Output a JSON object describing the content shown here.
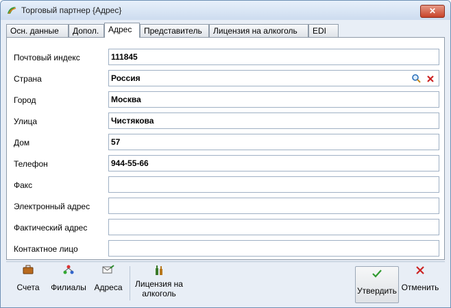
{
  "window": {
    "title": "Торговый партнер {Адрес}",
    "close_label": "✕"
  },
  "tabs": [
    {
      "label": "Осн. данные"
    },
    {
      "label": "Допол."
    },
    {
      "label": "Адрес"
    },
    {
      "label": "Представитель"
    },
    {
      "label": "Лицензия на алкоголь"
    },
    {
      "label": "EDI"
    }
  ],
  "form": {
    "postal_code": {
      "label": "Почтовый индекс",
      "value": "111845"
    },
    "country": {
      "label": "Страна",
      "value": "Россия"
    },
    "city": {
      "label": "Город",
      "value": "Москва"
    },
    "street": {
      "label": "Улица",
      "value": "Чистякова"
    },
    "house": {
      "label": "Дом",
      "value": "57"
    },
    "phone": {
      "label": "Телефон",
      "value": "944-55-66"
    },
    "fax": {
      "label": "Факс",
      "value": ""
    },
    "email": {
      "label": "Электронный адрес",
      "value": ""
    },
    "actual_address": {
      "label": "Фактический адрес",
      "value": ""
    },
    "contact": {
      "label": "Контактное лицо",
      "value": ""
    }
  },
  "toolbar": {
    "accounts": "Счета",
    "branches": "Филиалы",
    "addresses": "Адреса",
    "license_line1": "Лицензия на",
    "license_line2": "алкоголь",
    "confirm": "Утвердить",
    "cancel": "Отменить"
  },
  "colors": {
    "accent": "#6d8fb4",
    "confirm_check": "#2f9a2f",
    "cancel_x": "#cc2222",
    "close_button": "#c7432a"
  }
}
